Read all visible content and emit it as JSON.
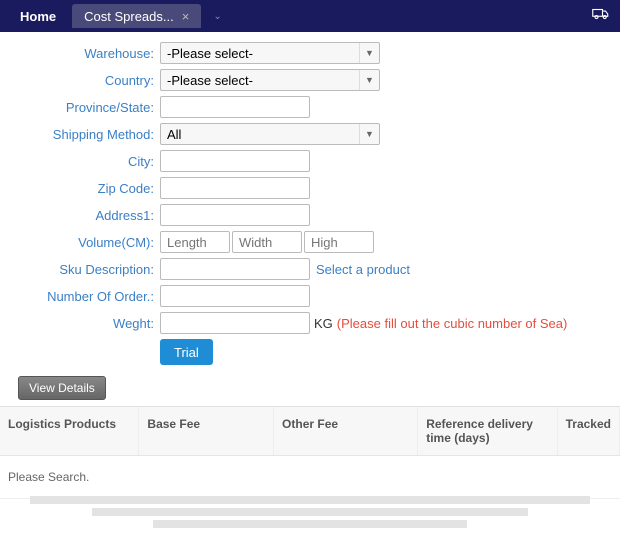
{
  "tabs": {
    "home": "Home",
    "active": "Cost Spreads...",
    "close": "×",
    "caret": "⌄"
  },
  "form": {
    "labels": {
      "warehouse": "Warehouse",
      "country": "Country",
      "province": "Province/State",
      "shipping": "Shipping Method",
      "city": "City",
      "zip": "Zip Code",
      "address1": "Address1",
      "volume": "Volume(CM)",
      "sku": "Sku Description",
      "orders": "Number Of Order.",
      "weight": "Weght"
    },
    "values": {
      "warehouse": "-Please select-",
      "country": "-Please select-",
      "shipping": "All"
    },
    "placeholders": {
      "length": "Length",
      "width": "Width",
      "high": "High"
    },
    "select_product": "Select a product",
    "kg": "KG",
    "weight_note": "(Please fill out the cubic number of Sea)",
    "trial": "Trial",
    "view_details": "View Details"
  },
  "table": {
    "headers": {
      "logistics": "Logistics Products",
      "base_fee": "Base Fee",
      "other_fee": "Other Fee",
      "reference": "Reference delivery time (days)",
      "tracked": "Tracked"
    },
    "empty": "Please Search."
  }
}
